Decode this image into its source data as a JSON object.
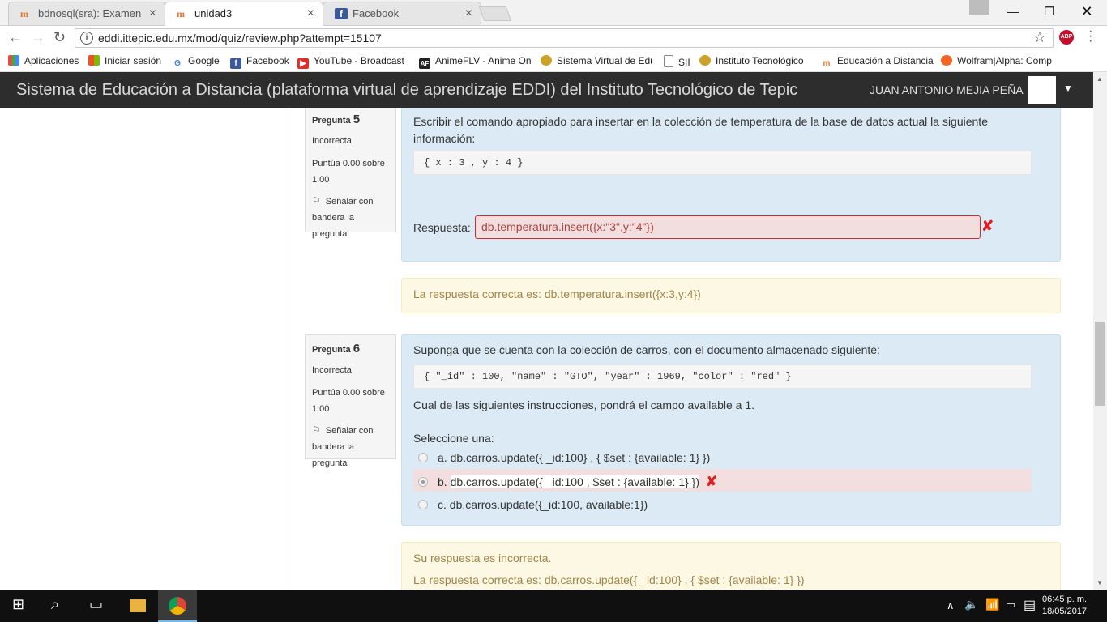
{
  "browser": {
    "tabs": [
      {
        "title": "bdnosql(sra): Examen uni",
        "active": false
      },
      {
        "title": "unidad3",
        "active": true
      },
      {
        "title": "Facebook",
        "active": false
      }
    ],
    "url": "eddi.ittepic.edu.mx/mod/quiz/review.php?attempt=15107",
    "bookmarks": [
      "Aplicaciones",
      "Iniciar sesión",
      "Google",
      "Facebook",
      "YouTube - Broadcast",
      "AnimeFLV - Anime On",
      "Sistema Virtual de Edu",
      "SII",
      "Instituto Tecnológico",
      "Educación a Distancia",
      "Wolfram|Alpha: Comp"
    ],
    "abp_label": "ABP"
  },
  "site": {
    "brand": "Sistema de Educación a Distancia (plataforma virtual de aprendizaje EDDI) del Instituto Tecnológico de Tepic",
    "user": "JUAN ANTONIO MEJIA PEÑA"
  },
  "q5": {
    "label": "Pregunta",
    "number": "5",
    "state": "Incorrecta",
    "grade": "Puntúa 0.00 sobre 1.00",
    "flag": "Señalar con bandera la pregunta",
    "text": "Escribir el comando apropiado para insertar en la colección de temperatura de la base de datos actual la siguiente información:",
    "code": "{ x : 3 , y : 4 }",
    "answer_label": "Respuesta:",
    "answer": "db.temperatura.insert({x:\"3\",y:\"4\"})",
    "correct": "La respuesta correcta es: db.temperatura.insert({x:3,y:4})"
  },
  "q6": {
    "label": "Pregunta",
    "number": "6",
    "state": "Incorrecta",
    "grade": "Puntúa 0.00 sobre 1.00",
    "flag": "Señalar con bandera la pregunta",
    "text": "Suponga que se cuenta con la colección de carros, con el documento almacenado siguiente:",
    "code": "{ \"_id\" : 100, \"name\" : \"GTO\", \"year\" : 1969, \"color\" : \"red\" }",
    "question": "Cual de las siguientes instrucciones, pondrá el campo available a 1.",
    "select_label": "Seleccione una:",
    "options": [
      {
        "letter": "a.",
        "text": "db.carros.update({ _id:100} , { $set : {available: 1} })",
        "selected": false
      },
      {
        "letter": "b.",
        "text": "db.carros.update({ _id:100 ,  $set : {available: 1} })",
        "selected": true
      },
      {
        "letter": "c.",
        "text": "db.carros.update({_id:100, available:1})",
        "selected": false
      }
    ],
    "feedback": "Su respuesta es incorrecta.",
    "correct": "La respuesta correcta es: db.carros.update({ _id:100} , { $set : {available: 1} })"
  },
  "taskbar": {
    "time": "06:45 p. m.",
    "date": "18/05/2017"
  },
  "colors": {
    "navbar": "#2d2d2d",
    "question_bg": "#dbeaf4",
    "feedback_bg": "#fcf8e3",
    "incorrect_bg": "#f2dede",
    "incorrect_mark": "#e02020"
  }
}
